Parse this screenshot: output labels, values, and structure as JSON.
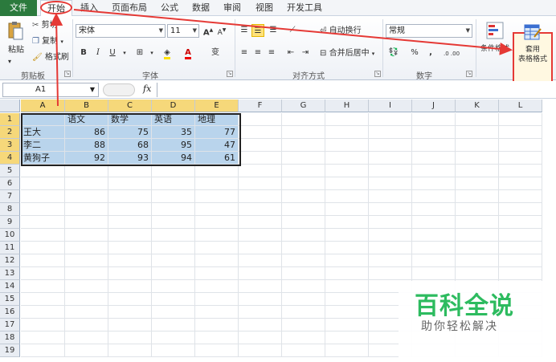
{
  "menu": {
    "file": "文件",
    "tabs": [
      "开始",
      "插入",
      "页面布局",
      "公式",
      "数据",
      "审阅",
      "视图",
      "开发工具"
    ]
  },
  "ribbon": {
    "clipboard": {
      "paste": "粘贴",
      "cut": "剪切",
      "copy": "复制",
      "format_painter": "格式刷",
      "group": "剪贴板"
    },
    "font": {
      "name": "宋体",
      "size": "11",
      "group": "字体",
      "bold": "B",
      "italic": "I",
      "underline": "U",
      "grow": "A",
      "shrink": "A",
      "phonetic": "变"
    },
    "alignment": {
      "wrap": "自动换行",
      "merge": "合并后居中",
      "group": "对齐方式"
    },
    "number": {
      "format": "常规",
      "percent": "%",
      "comma": ",",
      "inc_decimal": ".0 .00",
      "group": "数字"
    },
    "styles": {
      "conditional": "条件格式",
      "table_style_line1": "套用",
      "table_style_line2": "表格格式"
    }
  },
  "formula_bar": {
    "name_box": "A1",
    "fx": "fx",
    "value": ""
  },
  "columns": [
    "A",
    "B",
    "C",
    "D",
    "E",
    "F",
    "G",
    "H",
    "I",
    "J",
    "K",
    "L"
  ],
  "rows": [
    "1",
    "2",
    "3",
    "4",
    "5",
    "6",
    "7",
    "8",
    "9",
    "10",
    "11",
    "12",
    "13",
    "14",
    "15",
    "16",
    "17",
    "18",
    "19"
  ],
  "table": {
    "header": [
      "",
      "语文",
      "数学",
      "英语",
      "地理"
    ],
    "data": [
      [
        "王大",
        "86",
        "75",
        "35",
        "77"
      ],
      [
        "李二",
        "88",
        "68",
        "95",
        "47"
      ],
      [
        "黄狗子",
        "92",
        "93",
        "94",
        "61"
      ]
    ]
  },
  "watermark": {
    "title": "百科全说",
    "subtitle": "助你轻松解决"
  },
  "colors": {
    "file_tab": "#2b7a3d",
    "selection": "#b9d4ec",
    "header_selected": "#f6d87a",
    "annotation": "#e53935",
    "watermark": "#2dbb5f"
  }
}
